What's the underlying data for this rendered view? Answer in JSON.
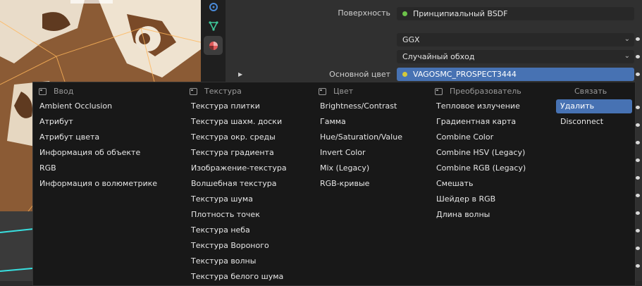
{
  "properties": {
    "surface_label": "Поверхность",
    "surface_value": "Принципиальный BSDF",
    "distribution_value": "GGX",
    "subsurface_value": "Случайный обход",
    "base_color_label": "Основной цвет",
    "base_color_value": "VAGOSMC_PROSPECT3444"
  },
  "colors": {
    "accent": "#4772b3",
    "socket_green": "#6cc24a",
    "socket_yellow": "#d4c93a"
  },
  "tools": [
    "physics-icon",
    "constraint-icon",
    "material-icon"
  ],
  "menu": {
    "columns": [
      {
        "header": "Ввод",
        "items": [
          "Ambient Occlusion",
          "Атрибут",
          "Атрибут цвета",
          "Информация об объекте",
          "RGB",
          "Информация о волюметрике"
        ]
      },
      {
        "header": "Текстура",
        "items": [
          "Текстура плитки",
          "Текстура шахм. доски",
          "Текстура окр. среды",
          "Текстура градиента",
          "Изображение-текстура",
          "Волшебная текстура",
          "Текстура шума",
          "Плотность точек",
          "Текстура неба",
          "Текстура Вороного",
          "Текстура волны",
          "Текстура белого шума"
        ]
      },
      {
        "header": "Цвет",
        "items": [
          "Brightness/Contrast",
          "Гамма",
          "Hue/Saturation/Value",
          "Invert Color",
          "Mix (Legacy)",
          "RGB-кривые"
        ]
      },
      {
        "header": "Преобразователь",
        "items": [
          "Тепловое излучение",
          "Градиентная карта",
          "Combine Color",
          "Combine HSV (Legacy)",
          "Combine RGB (Legacy)",
          "Смешать",
          "Шейдер в RGB",
          "Длина волны"
        ]
      },
      {
        "header": "Связать",
        "items": [
          "Удалить",
          "Disconnect"
        ]
      }
    ]
  }
}
